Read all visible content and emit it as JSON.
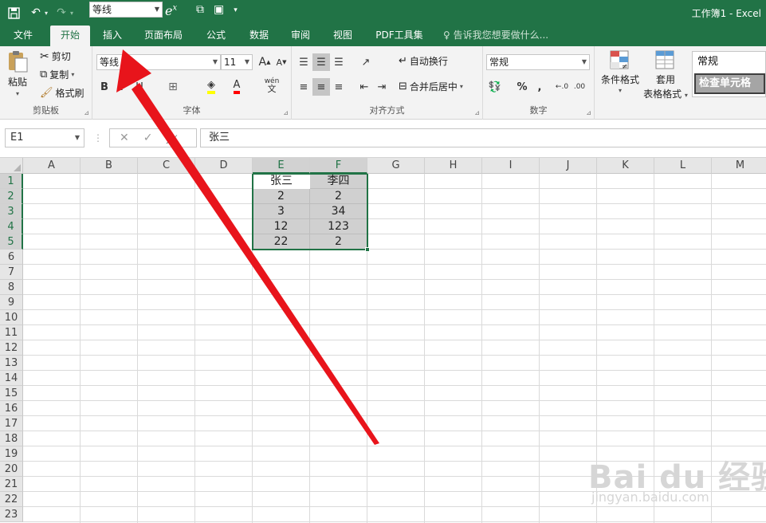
{
  "window": {
    "title": "工作簿1 - Excel",
    "qat_font": "等线",
    "theme_color": "#217346"
  },
  "tabs": [
    {
      "label": "文件",
      "active": false
    },
    {
      "label": "开始",
      "active": true
    },
    {
      "label": "插入",
      "active": false
    },
    {
      "label": "页面布局",
      "active": false
    },
    {
      "label": "公式",
      "active": false
    },
    {
      "label": "数据",
      "active": false
    },
    {
      "label": "审阅",
      "active": false
    },
    {
      "label": "视图",
      "active": false
    },
    {
      "label": "PDF工具集",
      "active": false
    }
  ],
  "tell_me": "告诉我您想要做什么...",
  "ribbon": {
    "clipboard": {
      "label": "剪贴板",
      "paste": "粘贴",
      "cut": "剪切",
      "copy": "复制",
      "format_painter": "格式刷"
    },
    "font": {
      "label": "字体",
      "font_name": "等线",
      "font_size": "11",
      "bold": "B",
      "italic": "I",
      "underline": "U",
      "grow": "A",
      "shrink": "A",
      "font_color": "A",
      "phonetic": "wén"
    },
    "alignment": {
      "label": "对齐方式",
      "wrap_text": "自动换行",
      "merge_center": "合并后居中"
    },
    "number": {
      "label": "数字",
      "format": "常规",
      "percent": "%",
      "comma": ","
    },
    "styles": {
      "conditional": "条件格式",
      "table_line1": "套用",
      "table_line2": "表格格式",
      "normal": "常规",
      "check_cell": "检查单元格"
    }
  },
  "formula_bar": {
    "name_box": "E1",
    "cancel": "✕",
    "enter": "✓",
    "fx": "fx",
    "value": "张三"
  },
  "columns": [
    "A",
    "B",
    "C",
    "D",
    "E",
    "F",
    "G",
    "H",
    "I",
    "J",
    "K",
    "L",
    "M"
  ],
  "rows": [
    "1",
    "2",
    "3",
    "4",
    "5",
    "6",
    "7",
    "8",
    "9",
    "10",
    "11",
    "12",
    "13",
    "14",
    "15",
    "16",
    "17",
    "18",
    "19",
    "20",
    "21",
    "22",
    "23"
  ],
  "selected_columns": [
    "E",
    "F"
  ],
  "selected_rows": [
    "1",
    "2",
    "3",
    "4",
    "5"
  ],
  "table": {
    "E": [
      "张三",
      "2",
      "3",
      "12",
      "22"
    ],
    "F": [
      "李四",
      "2",
      "34",
      "123",
      "2"
    ]
  },
  "watermark": {
    "logo": "Bai du 经验",
    "site": "jingyan.baidu.com"
  },
  "annotation": {
    "color": "#e8141b"
  }
}
